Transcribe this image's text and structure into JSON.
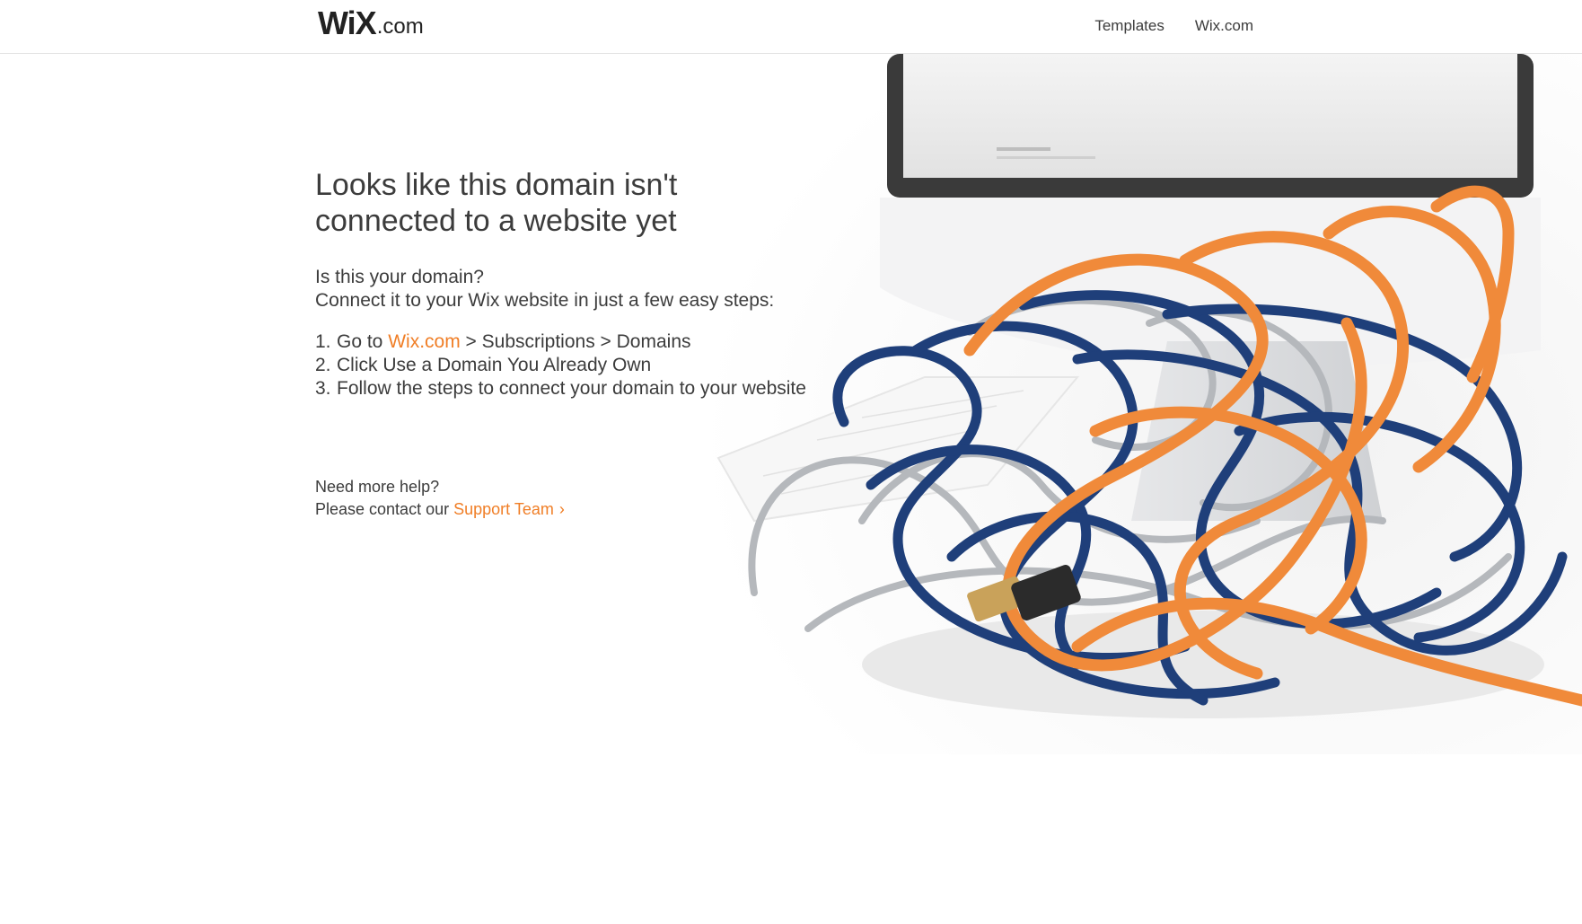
{
  "header": {
    "logo_wix": "WiX",
    "logo_com": ".com",
    "nav": [
      {
        "label": "Templates"
      },
      {
        "label": "Wix.com"
      }
    ]
  },
  "main": {
    "headline_line1": "Looks like this domain isn't",
    "headline_line2": "connected to a website yet",
    "intro_line1": "Is this your domain?",
    "intro_line2": "Connect it to your Wix website in just a few easy steps:",
    "steps": [
      {
        "num": "1.",
        "prefix": "Go to ",
        "link": "Wix.com",
        "suffix": " > Subscriptions > Domains"
      },
      {
        "num": "2.",
        "text": "Click Use a Domain You Already Own"
      },
      {
        "num": "3.",
        "text": "Follow the steps to connect your domain to your website"
      }
    ],
    "help_line1": "Need more help?",
    "help_prefix": "Please contact our ",
    "support_link": "Support Team",
    "support_chevron": "›"
  },
  "colors": {
    "accent": "#f07e26",
    "text": "#3c3c3c",
    "cable_blue": "#1f3f7a",
    "cable_orange": "#f08a3a",
    "cable_silver": "#b5b8bc"
  },
  "icons": {
    "illustration": "tangled-cables-monitor-image"
  }
}
